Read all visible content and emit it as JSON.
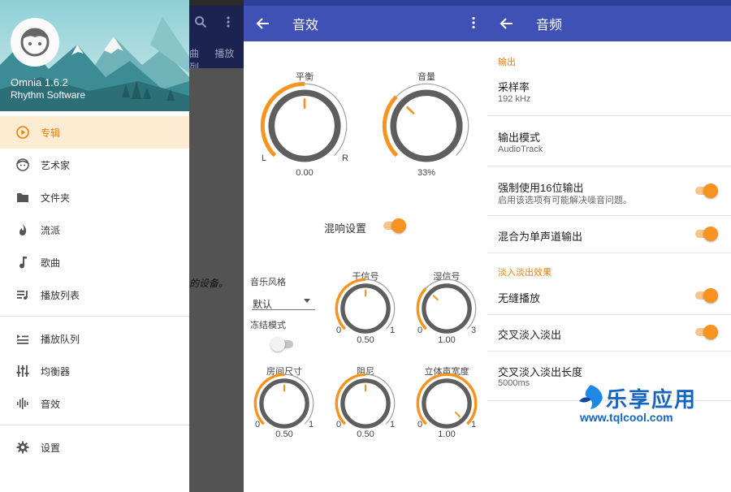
{
  "drawer": {
    "app_name": "Omnia 1.6.2",
    "developer": "Rhythm Software",
    "items": [
      {
        "label": "专辑",
        "icon": "play-circle-icon",
        "selected": true
      },
      {
        "label": "艺术家",
        "icon": "face-icon"
      },
      {
        "label": "文件夹",
        "icon": "folder-icon"
      },
      {
        "label": "流派",
        "icon": "flame-icon"
      },
      {
        "label": "歌曲",
        "icon": "music-note-icon"
      },
      {
        "label": "播放列表",
        "icon": "playlist-icon"
      },
      {
        "label": "播放队列",
        "icon": "queue-icon"
      },
      {
        "label": "均衡器",
        "icon": "equalizer-icon"
      },
      {
        "label": "音效",
        "icon": "waveform-icon"
      },
      {
        "label": "设置",
        "icon": "gear-icon"
      }
    ]
  },
  "background_app": {
    "tabs": [
      "曲",
      "播放列"
    ],
    "body_text": "的设备。"
  },
  "sound_effects": {
    "title": "音效",
    "balance": {
      "label": "平衡",
      "value": "0.00",
      "left": "L",
      "right": "R",
      "level": 0.5
    },
    "volume": {
      "label": "音量",
      "value": "33%",
      "level": 0.33
    },
    "reverb_toggle": {
      "label": "混响设置",
      "on": true
    },
    "music_style": {
      "label": "音乐风格",
      "selected": "默认"
    },
    "freeze": {
      "label": "冻结模式",
      "on": false
    },
    "dry": {
      "label": "干信号",
      "value": "0.50",
      "min": "0",
      "max": "1",
      "level": 0.5
    },
    "wet": {
      "label": "湿信号",
      "value": "1.00",
      "min": "0",
      "max": "3",
      "level": 0.33
    },
    "room": {
      "label": "房间尺寸",
      "value": "0.50",
      "min": "0",
      "max": "1",
      "level": 0.5
    },
    "damping": {
      "label": "阻尼",
      "value": "0.50",
      "min": "0",
      "max": "1",
      "level": 0.5
    },
    "width": {
      "label": "立体声宽度",
      "value": "1.00",
      "min": "0",
      "max": "1",
      "level": 1.0
    }
  },
  "audio": {
    "title": "音频",
    "output_section": "输出",
    "sample_rate": {
      "title": "采样率",
      "value": "192 kHz"
    },
    "output_mode": {
      "title": "输出模式",
      "value": "AudioTrack"
    },
    "force16": {
      "title": "强制使用16位输出",
      "desc": "启用该选项有可能解决噪音问题。",
      "on": true
    },
    "mono": {
      "title": "混合为单声道输出",
      "on": true
    },
    "fade_section": "淡入淡出效果",
    "gapless": {
      "title": "无缝播放",
      "on": true
    },
    "crossfade": {
      "title": "交叉淡入淡出",
      "on": true
    },
    "crossfade_len": {
      "title": "交叉淡入淡出长度",
      "value": "5000ms"
    }
  },
  "watermark": {
    "name": "乐享应用",
    "url": "www.tqlcool.com"
  },
  "colors": {
    "primary": "#3f51b5",
    "accent": "#f7931e",
    "highlight": "#fdebd2"
  }
}
